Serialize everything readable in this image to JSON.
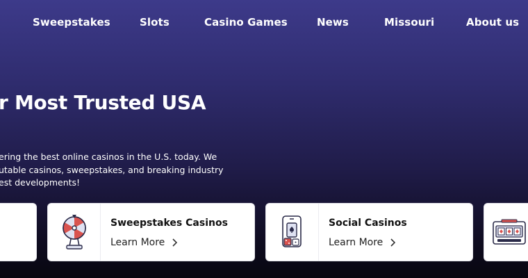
{
  "nav": {
    "items": [
      {
        "label": "Sweepstakes"
      },
      {
        "label": "Slots"
      },
      {
        "label": "Casino Games"
      },
      {
        "label": "News"
      },
      {
        "label": "Missouri"
      },
      {
        "label": "About us"
      }
    ]
  },
  "hero": {
    "title": "r Most Trusted USA",
    "description_lines": [
      "ering the best online casinos in the U.S. today.  We",
      "utable casinos, sweepstakes, and breaking industry",
      "est developments!"
    ]
  },
  "cards": [
    {
      "title": "",
      "link_label": "",
      "icon": "partial-card"
    },
    {
      "title": "Sweepstakes Casinos",
      "link_label": "Learn More",
      "icon": "prize-wheel-icon"
    },
    {
      "title": "Social Casinos",
      "link_label": "Learn More",
      "icon": "phone-cards-dice-icon"
    },
    {
      "title": "",
      "link_label": "",
      "icon": "slot-machine-icon"
    }
  ],
  "colors": {
    "accent_red": "#d9534f",
    "icon_stroke": "#2a2a48",
    "icon_fill_light": "#dfe2f2"
  }
}
